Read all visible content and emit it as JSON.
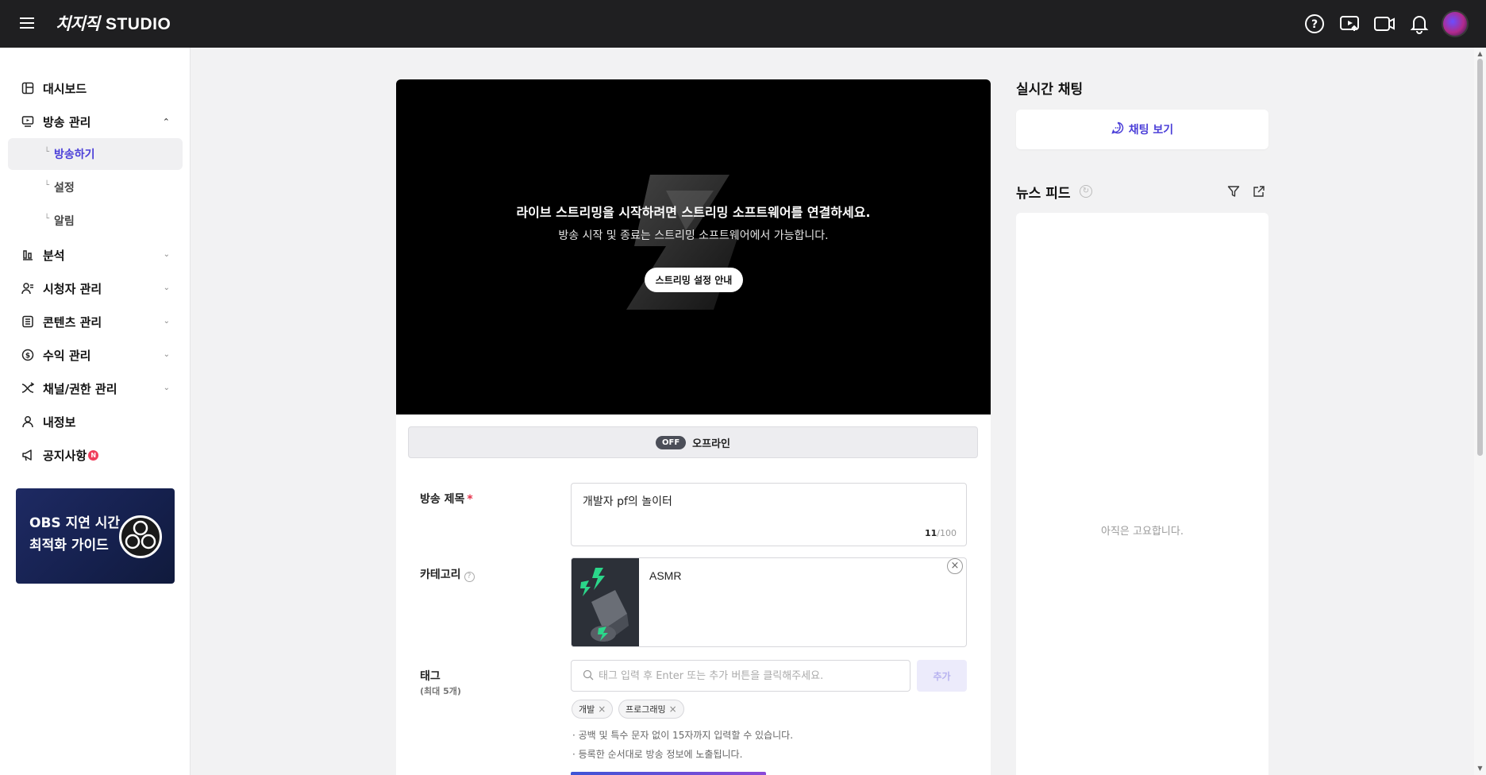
{
  "header": {
    "brand": "치지직",
    "studio": "STUDIO"
  },
  "sidebar": {
    "items": [
      {
        "label": "대시보드",
        "icon": "dashboard-icon"
      },
      {
        "label": "방송 관리",
        "icon": "broadcast-icon",
        "expanded": true
      },
      {
        "label": "분석",
        "icon": "chart-icon"
      },
      {
        "label": "시청자 관리",
        "icon": "viewers-icon"
      },
      {
        "label": "콘텐츠 관리",
        "icon": "content-icon"
      },
      {
        "label": "수익 관리",
        "icon": "dollar-icon"
      },
      {
        "label": "채널/권한 관리",
        "icon": "shuffle-icon"
      },
      {
        "label": "내정보",
        "icon": "person-icon"
      },
      {
        "label": "공지사항",
        "icon": "megaphone-icon",
        "badge": "N"
      }
    ],
    "sub_items": [
      {
        "label": "방송하기",
        "active": true
      },
      {
        "label": "설정"
      },
      {
        "label": "알림"
      }
    ],
    "promo": {
      "text": "OBS 지연 시간\n최적화 가이드"
    }
  },
  "video": {
    "title": "라이브 스트리밍을 시작하려면 스트리밍 소프트웨어를 연결하세요.",
    "subtitle": "방송 시작 및 종료는 스트리밍 소프트웨어에서 가능합니다.",
    "guide_button": "스트리밍 설정 안내"
  },
  "status": {
    "badge": "OFF",
    "text": "오프라인"
  },
  "form": {
    "title_label": "방송 제목",
    "title_required": "*",
    "title_value": "개발자 pf의 놀이터",
    "title_count": "11",
    "title_max": "/100",
    "category_label": "카테고리",
    "category_help": "?",
    "category_value": "ASMR",
    "tag_label": "태그",
    "tag_sublabel": "(최대 5개)",
    "tag_placeholder": "태그 입력 후 Enter 또는 추가 버튼을 클릭해주세요.",
    "tag_add": "추가",
    "tags": [
      "개발",
      "프로그래밍"
    ],
    "notes": [
      "· 공백 및 특수 문자 없이 15자까지 입력할 수 있습니다.",
      "· 등록한 순서대로 방송 정보에 노출됩니다."
    ]
  },
  "right": {
    "chat_title": "실시간 채팅",
    "chat_button": "채팅 보기",
    "feed_title": "뉴스 피드",
    "feed_empty": "아직은 고요합니다."
  },
  "colors": {
    "accent": "#4b3fd8",
    "header_bg": "#1f1f21",
    "required": "#e5324b"
  }
}
